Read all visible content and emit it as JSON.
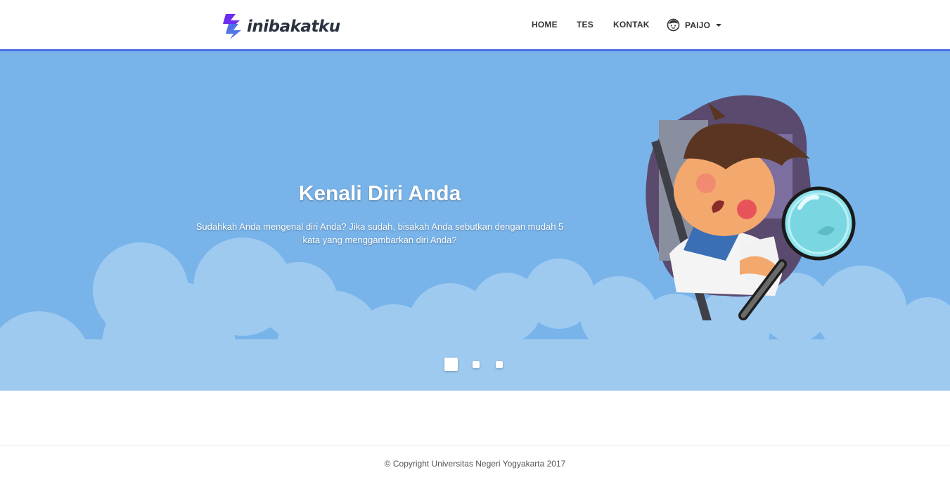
{
  "brand": {
    "name": "inibakatku",
    "logo_icon": "lightning-logo-icon",
    "accent": "#4a6ee8",
    "logo_colors": [
      "#6c2df0",
      "#4a6ee8"
    ]
  },
  "nav": {
    "items": [
      {
        "label": "HOME"
      },
      {
        "label": "TES"
      },
      {
        "label": "KONTAK"
      }
    ],
    "user": {
      "label": "PAIJO",
      "icon": "user-face-icon",
      "dropdown_icon": "caret-down-icon"
    }
  },
  "hero": {
    "background": "#78b4ea",
    "cloud_color": "#9ecaf0",
    "slides": [
      {
        "title": "Kenali Diri Anda",
        "text": "Sudahkah Anda mengenal diri Anda? Jika sudah, bisakah Anda sebutkan dengan mudah 5 kata yang menggambarkan diri Anda?",
        "illustration": "boy-with-magnifying-glass-illustration"
      }
    ],
    "active_slide": 1,
    "slide_count": 3
  },
  "footer": {
    "copyright": "© Copyright Universitas Negeri Yogyakarta 2017"
  }
}
